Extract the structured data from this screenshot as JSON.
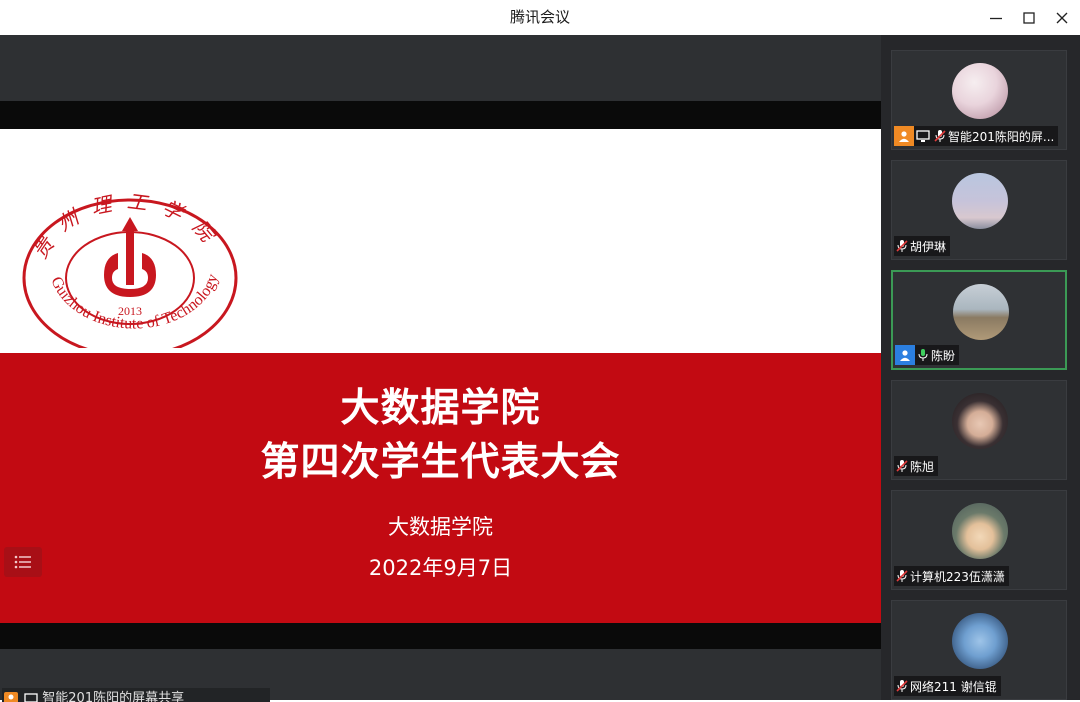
{
  "window": {
    "title": "腾讯会议"
  },
  "slide": {
    "title_line1": "大数据学院",
    "title_line2": "第四次学生代表大会",
    "subtitle": "大数据学院",
    "date": "2022年9月7日",
    "logo_text": {
      "top_arc": "贵州理工学院",
      "bottom_arc": "Guizhou Institute of Technology",
      "year": "2013"
    },
    "colors": {
      "band": "#c20a12",
      "logo": "#c8171f"
    }
  },
  "presenter_label": "智能201陈阳的屏幕共享",
  "participants": [
    {
      "name": "智能201陈阳的屏...",
      "role": "host",
      "sharing": true,
      "muted": true
    },
    {
      "name": "胡伊琳",
      "muted": true
    },
    {
      "name": "陈盼",
      "role": "cohost",
      "muted": false,
      "speaking": true
    },
    {
      "name": "陈旭",
      "muted": true
    },
    {
      "name": "计算机223伍潇潇",
      "muted": true
    },
    {
      "name": "网络211 谢信锟",
      "muted": true
    }
  ],
  "icons": {
    "minimize": "minimize-icon",
    "maximize": "maximize-icon",
    "close": "close-icon",
    "menu": "list-menu-icon",
    "mic_muted": "mic-muted-icon",
    "mic_on": "mic-on-icon",
    "host": "host-icon",
    "screen_share": "screen-share-icon"
  }
}
